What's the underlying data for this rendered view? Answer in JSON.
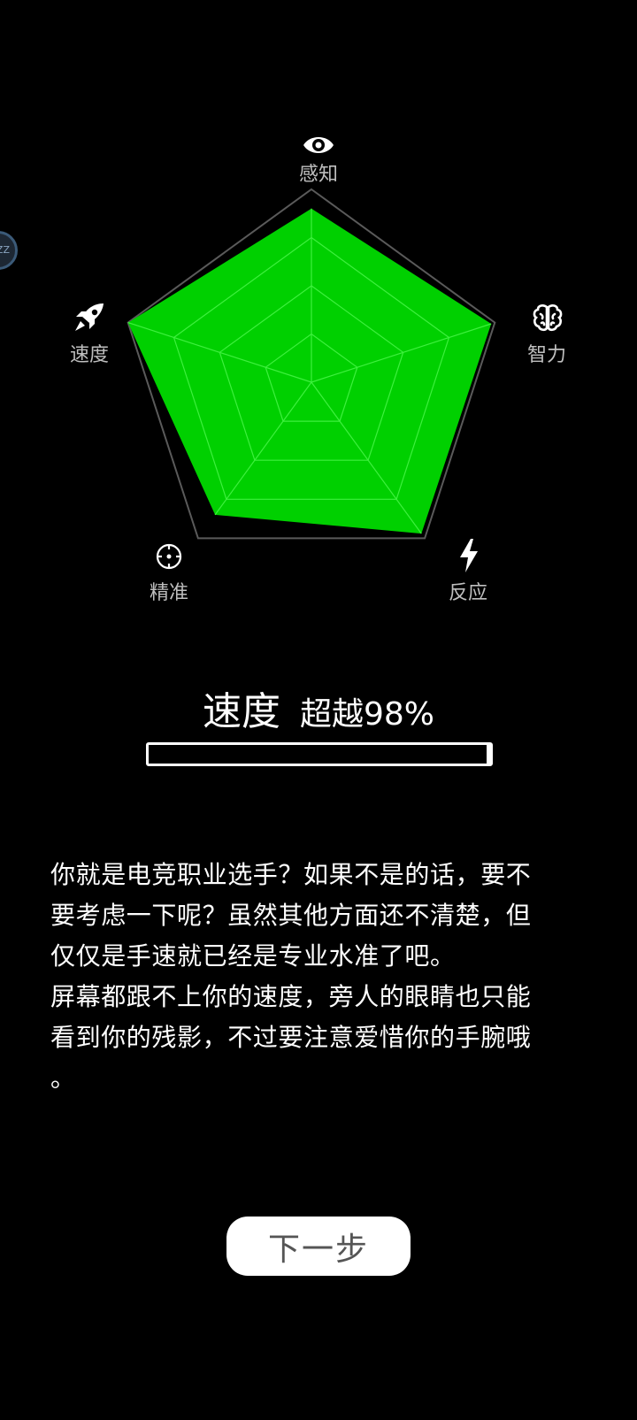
{
  "floating_bubble": {
    "label": "ZZ"
  },
  "radar": {
    "axes": [
      {
        "key": "perception",
        "label": "感知",
        "icon": "eye-icon",
        "value": 0.9
      },
      {
        "key": "intelligence",
        "label": "智力",
        "icon": "brain-icon",
        "value": 0.98
      },
      {
        "key": "reaction",
        "label": "反应",
        "icon": "lightning-icon",
        "value": 0.97
      },
      {
        "key": "precision",
        "label": "精准",
        "icon": "crosshair-icon",
        "value": 0.85
      },
      {
        "key": "speed",
        "label": "速度",
        "icon": "rocket-icon",
        "value": 1.0
      }
    ],
    "fill_color": "#00d000",
    "grid_color": "#3ef03e",
    "outline_color": "#5a5a5a"
  },
  "result": {
    "title": "速度",
    "percent_text": "超越98%",
    "progress": 0.99
  },
  "description": "你就是电竞职业选手？如果不是的话，要不\n要考虑一下呢？虽然其他方面还不清楚，但\n仅仅是手速就已经是专业水准了吧。\n屏幕都跟不上你的速度，旁人的眼睛也只能\n看到你的残影，不过要注意爱惜你的手腕哦\n。",
  "next_button": {
    "label": "下一步"
  }
}
